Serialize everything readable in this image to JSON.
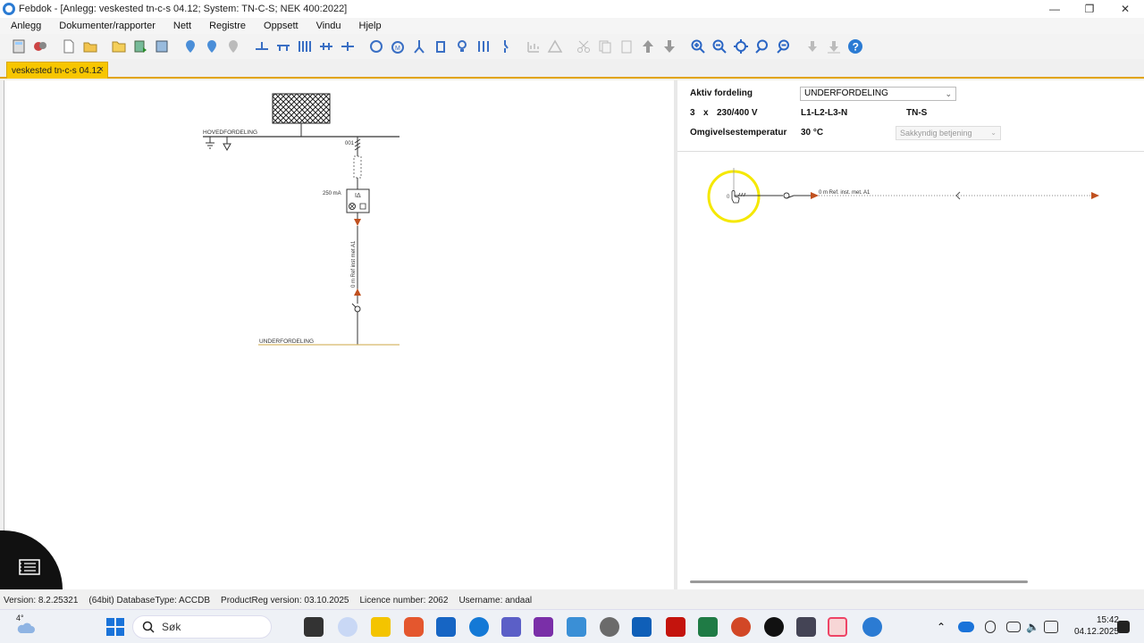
{
  "window": {
    "title": "Febdok - [Anlegg: veskested tn-c-s 04.12; System: TN-C-S; NEK 400:2022]",
    "controls": [
      "—",
      "❐",
      "✕"
    ]
  },
  "menu": [
    "Anlegg",
    "Dokumenter/rapporter",
    "Nett",
    "Registre",
    "Oppsett",
    "Vindu",
    "Hjelp"
  ],
  "document_tab": {
    "label": "veskested tn-c-s 04.12",
    "close": "×"
  },
  "diagram": {
    "main_bus_label": "HOVEDFORDELING",
    "breaker_label": "001",
    "rcd_label": "250 mA",
    "rcd_symbol": "IΔ",
    "cable_label": "0 m Ref inst met A1",
    "sub_bus_label": "UNDERFORDELING"
  },
  "properties": {
    "aktiv_fordeling_label": "Aktiv fordeling",
    "aktiv_fordeling_value": "UNDERFORDELING",
    "phases": "3",
    "x": "x",
    "voltage": "230/400 V",
    "conductors": "L1-L2-L3-N",
    "system": "TN-S",
    "temp_label": "Omgivelsestemperatur",
    "temp_value": "30 °C",
    "operation_select": "Sakkyndig betjening"
  },
  "line_view": {
    "left_label": "0",
    "cable_label": "0 m   Ref. inst. met. A1"
  },
  "status": {
    "version": "Version: 8.2.25321",
    "arch": "(64bit) DatabaseType: ACCDB",
    "productreg": "ProductReg version: 03.10.2025",
    "licence": "Licence number: 2062",
    "username": "Username: andaal"
  },
  "taskbar": {
    "weather": "4°",
    "search_placeholder": "Søk",
    "time": "15:42",
    "date": "04.12.2025"
  },
  "colors": {
    "tab_accent": "#f7c600",
    "arrow": "#c0501f",
    "cursor_highlight": "#f5e800",
    "sub_bus": "#d7b96a"
  }
}
